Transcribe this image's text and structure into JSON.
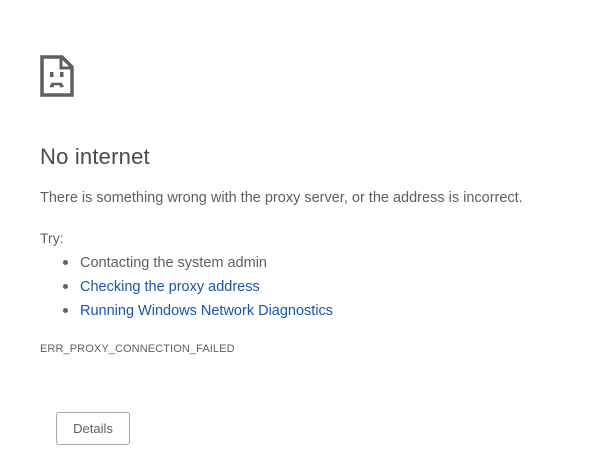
{
  "error": {
    "icon": "sad-page-icon",
    "title": "No internet",
    "description": "There is something wrong with the proxy server, or the address is incorrect.",
    "try_label": "Try:",
    "suggestions": [
      {
        "text": "Contacting the system admin",
        "is_link": false
      },
      {
        "text": "Checking the proxy address",
        "is_link": true
      },
      {
        "text": "Running Windows Network Diagnostics",
        "is_link": true
      }
    ],
    "code": "ERR_PROXY_CONNECTION_FAILED",
    "details_label": "Details"
  },
  "colors": {
    "link": "#1a56a8",
    "text": "#5f5f5f",
    "title": "#4a4a4a",
    "icon": "#5f5f5f"
  }
}
